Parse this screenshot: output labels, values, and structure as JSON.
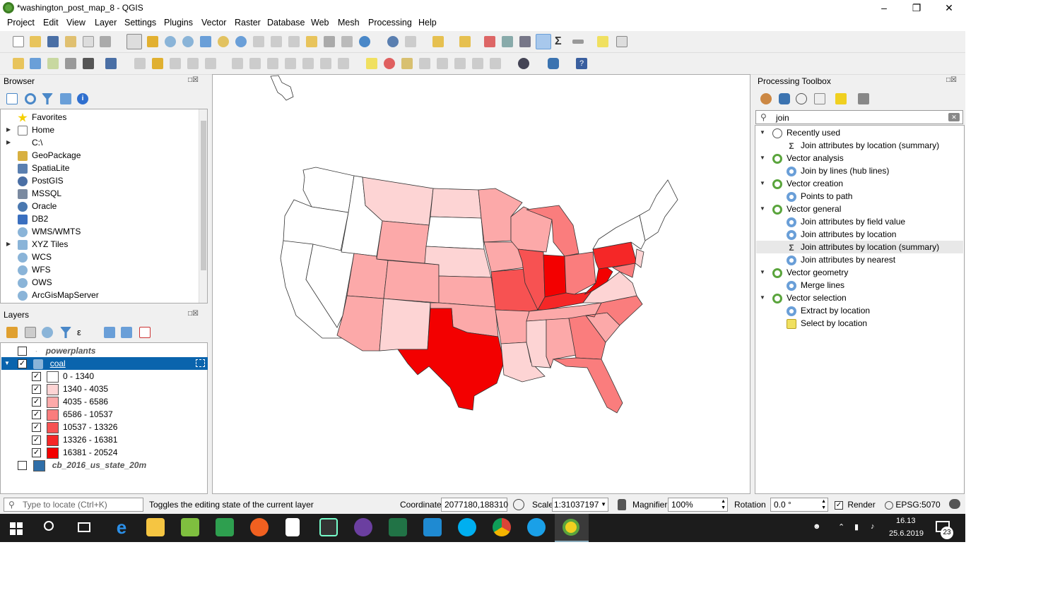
{
  "window": {
    "title": "*washington_post_map_8 - QGIS"
  },
  "menu": [
    "Project",
    "Edit",
    "View",
    "Layer",
    "Settings",
    "Plugins",
    "Vector",
    "Raster",
    "Database",
    "Web",
    "Mesh",
    "Processing",
    "Help"
  ],
  "browser": {
    "title": "Browser",
    "items": [
      "Favorites",
      "Home",
      "C:\\",
      "GeoPackage",
      "SpatiaLite",
      "PostGIS",
      "MSSQL",
      "Oracle",
      "DB2",
      "WMS/WMTS",
      "XYZ Tiles",
      "WCS",
      "WFS",
      "OWS",
      "ArcGisMapServer"
    ]
  },
  "layers": {
    "title": "Layers",
    "powerplants": "powerplants",
    "coal": "coal",
    "classes": [
      {
        "label": "0 - 1340",
        "color": "#ffffff"
      },
      {
        "label": "1340 - 4035",
        "color": "#fdd4d4"
      },
      {
        "label": "4035 - 6586",
        "color": "#fca9a9"
      },
      {
        "label": "6586 - 10537",
        "color": "#fa7d7d"
      },
      {
        "label": "10537 - 13326",
        "color": "#f75252"
      },
      {
        "label": "13326 - 16381",
        "color": "#f52727"
      },
      {
        "label": "16381 - 20524",
        "color": "#f30000"
      }
    ],
    "states": "cb_2016_us_state_20m"
  },
  "toolbox": {
    "title": "Processing Toolbox",
    "search": "join",
    "groups": [
      {
        "name": "Recently used",
        "items": [
          "Join attributes by location (summary)"
        ]
      },
      {
        "name": "Vector analysis",
        "items": [
          "Join by lines (hub lines)"
        ]
      },
      {
        "name": "Vector creation",
        "items": [
          "Points to path"
        ]
      },
      {
        "name": "Vector general",
        "items": [
          "Join attributes by field value",
          "Join attributes by location",
          "Join attributes by location (summary)",
          "Join attributes by nearest"
        ]
      },
      {
        "name": "Vector geometry",
        "items": [
          "Merge lines"
        ]
      },
      {
        "name": "Vector selection",
        "items": [
          "Extract by location",
          "Select by location"
        ]
      }
    ]
  },
  "status": {
    "locate_placeholder": "Type to locate (Ctrl+K)",
    "message": "Toggles the editing state of the current layer",
    "coordinate_label": "Coordinate",
    "coordinate": "2077180,188310",
    "scale_label": "Scale",
    "scale": "1:31037197",
    "magnifier_label": "Magnifier",
    "magnifier": "100%",
    "rotation_label": "Rotation",
    "rotation": "0.0 °",
    "render_label": "Render",
    "crs": "EPSG:5070"
  },
  "taskbar": {
    "time": "16.13",
    "date": "25.6.2019",
    "notifications": "23"
  }
}
